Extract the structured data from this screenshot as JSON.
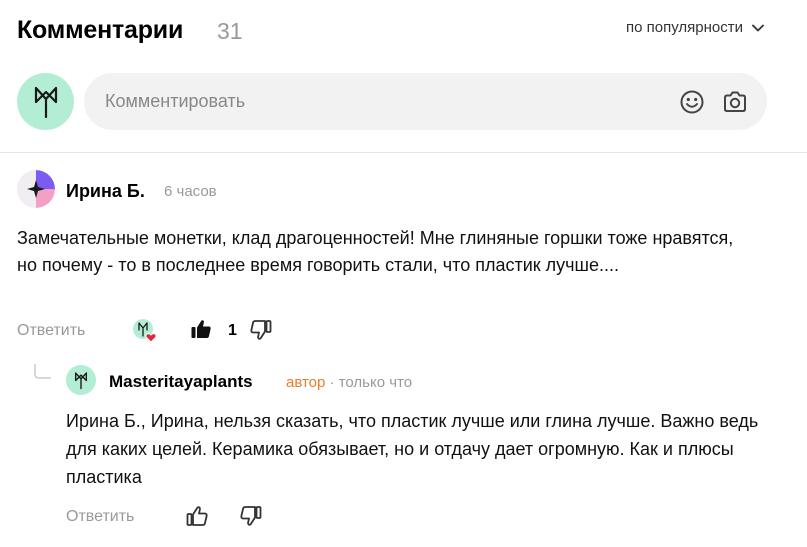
{
  "header": {
    "title": "Комментарии",
    "count": "31",
    "sort_label": "по популярности",
    "sort_icon": "chevron-down-icon"
  },
  "composer": {
    "placeholder": "Комментировать",
    "emoji_icon": "emoji-icon",
    "camera_icon": "camera-icon"
  },
  "comment": {
    "author": "Ирина Б.",
    "time": "6 часов",
    "text": "Замечательные монетки, клад драгоценностей! Мне глиняные горшки тоже нравятся, но почему - то в последнее время говорить стали, что пластик лучше....",
    "reply_label": "Ответить",
    "likes": "1"
  },
  "reply": {
    "author": "Masteritayaplants",
    "badge": "автор",
    "separator": " · ",
    "time": "только что",
    "text": "Ирина Б., Ирина, нельзя сказать, что пластик лучше или глина лучше. Важно ведь для каких целей. Керамика обязывает, но и отдачу дает огромную. Как и плюсы пластика",
    "reply_label": "Ответить"
  },
  "colors": {
    "accent_orange": "#f07a2b",
    "avatar_mint": "#b3eed4",
    "muted": "#999999"
  }
}
